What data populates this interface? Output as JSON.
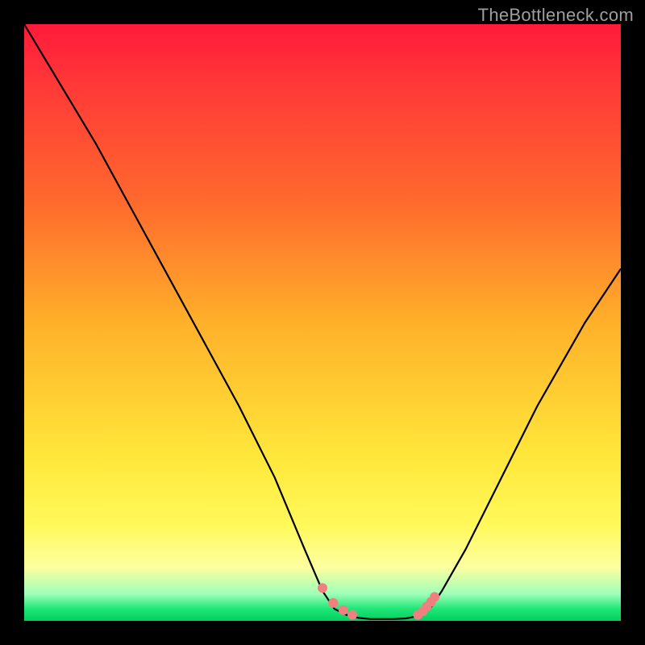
{
  "watermark": "TheBottleneck.com",
  "chart_data": {
    "type": "line",
    "title": "",
    "xlabel": "",
    "ylabel": "",
    "xlim": [
      0,
      100
    ],
    "ylim": [
      0,
      100
    ],
    "left_curve": {
      "x": [
        0,
        6,
        12,
        18,
        24,
        30,
        36,
        42,
        47,
        50,
        52,
        54,
        56
      ],
      "y": [
        100,
        90,
        80,
        69,
        58,
        47,
        36,
        24,
        12,
        5,
        2,
        1,
        0.5
      ]
    },
    "valley_floor": {
      "x": [
        56,
        58,
        60,
        62,
        64,
        66
      ],
      "y": [
        0.5,
        0.3,
        0.3,
        0.3,
        0.4,
        0.8
      ]
    },
    "right_curve": {
      "x": [
        66,
        68,
        70,
        74,
        78,
        82,
        86,
        90,
        94,
        98,
        100
      ],
      "y": [
        0.8,
        2,
        5,
        12,
        20,
        28,
        36,
        43,
        50,
        56,
        59
      ]
    },
    "dots_left": {
      "x": [
        50.0,
        51.8,
        53.5,
        55.0
      ],
      "y": [
        5.5,
        3.0,
        1.8,
        1.0
      ]
    },
    "dots_right": {
      "x": [
        66.0,
        66.8,
        67.5,
        68.2,
        68.8
      ],
      "y": [
        1.0,
        1.6,
        2.4,
        3.2,
        4.0
      ]
    },
    "colors": {
      "curve": "#000000",
      "dots": "#f08080"
    }
  }
}
